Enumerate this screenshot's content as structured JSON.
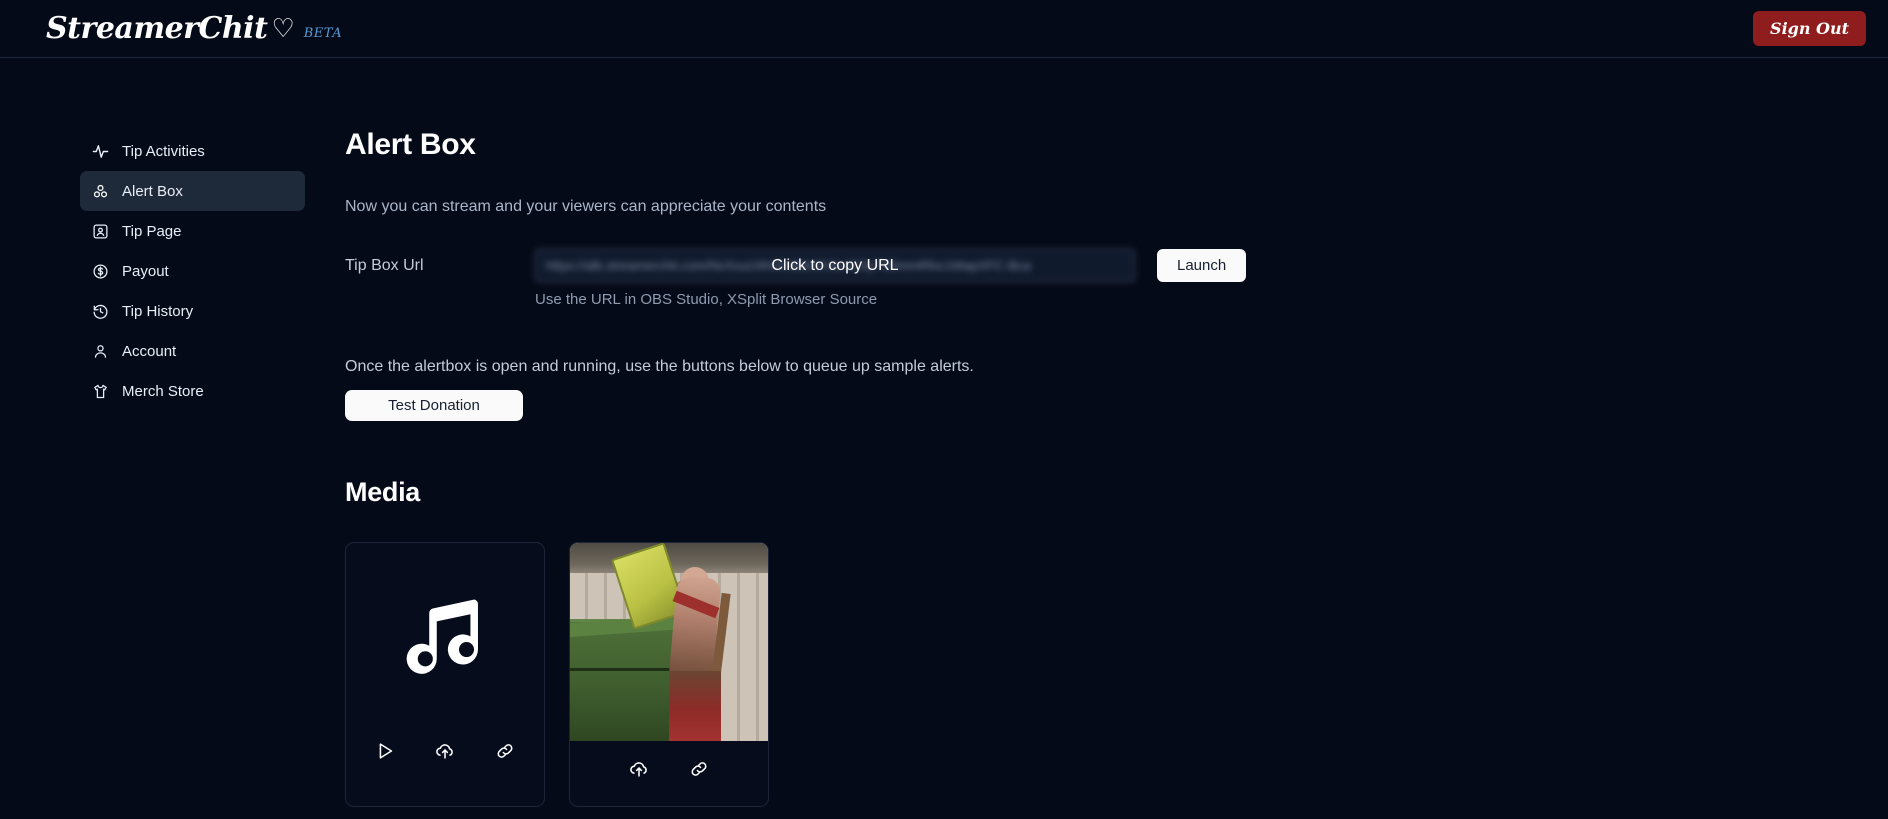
{
  "header": {
    "brand_name": "StreamerChit",
    "brand_heart_icon": "heart-icon",
    "beta_label": "BETA",
    "signout_label": "Sign Out"
  },
  "sidebar": {
    "items": [
      {
        "label": "Tip Activities",
        "icon": "activity-pulse-icon",
        "active": false
      },
      {
        "label": "Alert Box",
        "icon": "alert-box-circles-icon",
        "active": true
      },
      {
        "label": "Tip Page",
        "icon": "id-card-icon",
        "active": false
      },
      {
        "label": "Payout",
        "icon": "dollar-circle-icon",
        "active": false
      },
      {
        "label": "Tip History",
        "icon": "history-clock-icon",
        "active": false
      },
      {
        "label": "Account",
        "icon": "user-icon",
        "active": false
      },
      {
        "label": "Merch Store",
        "icon": "tshirt-icon",
        "active": false
      }
    ]
  },
  "main": {
    "page_title": "Alert Box",
    "subtitle": "Now you can stream and your viewers can appreciate your contents",
    "url_label": "Tip Box Url",
    "url_value": "https://alb.streamerchit.com/NxXxuiJ4hGhMkKKh9c4C8yT90mmRfoc1MapXFC-Bca",
    "url_tooltip": "Click to copy URL",
    "launch_label": "Launch",
    "hint": "Use the URL in OBS Studio, XSplit Browser Source",
    "queue_text": "Once the alertbox is open and running, use the buttons below to queue up sample alerts.",
    "test_donation_label": "Test Donation",
    "media_title": "Media",
    "media_cards": [
      {
        "kind": "audio",
        "art_icon": "music-note-icon",
        "actions": [
          "play-icon",
          "cloud-upload-icon",
          "link-icon"
        ]
      },
      {
        "kind": "image",
        "art_icon": "image-thumbnail",
        "actions": [
          "cloud-upload-icon",
          "link-icon"
        ]
      }
    ]
  },
  "colors": {
    "background": "#050a18",
    "sidebar_active": "#1e2939",
    "accent_beta": "#5b9bd5",
    "signout": "#8f1d1d",
    "button_light": "#fafafa",
    "text_muted": "#aab6c8"
  }
}
